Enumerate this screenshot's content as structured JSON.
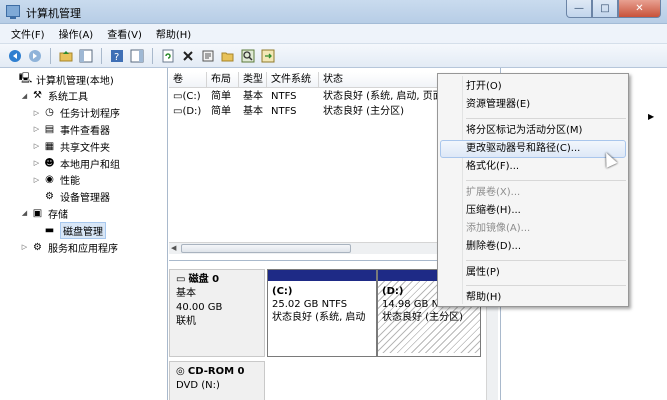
{
  "window": {
    "title": "计算机管理"
  },
  "window_buttons": {
    "minimize": "—",
    "maximize": "□",
    "close": "✕"
  },
  "menu": [
    "文件(F)",
    "操作(A)",
    "查看(V)",
    "帮助(H)"
  ],
  "toolbar_icons": [
    "back-icon",
    "forward-icon",
    "up-folder-icon",
    "show-tree-icon",
    "help-icon",
    "show-actions-icon",
    "refresh-icon",
    "delete-icon",
    "properties-icon",
    "open-icon",
    "search-icon",
    "export-icon"
  ],
  "tree": [
    {
      "label": "计算机管理(本地)",
      "icon": "computer-icon",
      "level": 0,
      "expander": "",
      "selected": false
    },
    {
      "label": "系统工具",
      "icon": "tools-icon",
      "level": 1,
      "expander": "◢",
      "selected": false
    },
    {
      "label": "任务计划程序",
      "icon": "clock-icon",
      "level": 2,
      "expander": "▷",
      "selected": false
    },
    {
      "label": "事件查看器",
      "icon": "event-viewer-icon",
      "level": 2,
      "expander": "▷",
      "selected": false
    },
    {
      "label": "共享文件夹",
      "icon": "shared-folder-icon",
      "level": 2,
      "expander": "▷",
      "selected": false
    },
    {
      "label": "本地用户和组",
      "icon": "users-icon",
      "level": 2,
      "expander": "▷",
      "selected": false
    },
    {
      "label": "性能",
      "icon": "performance-icon",
      "level": 2,
      "expander": "▷",
      "selected": false
    },
    {
      "label": "设备管理器",
      "icon": "device-manager-icon",
      "level": 2,
      "expander": "",
      "selected": false
    },
    {
      "label": "存储",
      "icon": "storage-icon",
      "level": 1,
      "expander": "◢",
      "selected": false
    },
    {
      "label": "磁盘管理",
      "icon": "disk-management-icon",
      "level": 2,
      "expander": "",
      "selected": true
    },
    {
      "label": "服务和应用程序",
      "icon": "services-icon",
      "level": 1,
      "expander": "▷",
      "selected": false
    }
  ],
  "list": {
    "columns": [
      "卷",
      "布局",
      "类型",
      "文件系统",
      "状态"
    ],
    "rows": [
      [
        "(C:)",
        "简单",
        "基本",
        "NTFS",
        "状态良好 (系统, 启动, 页面"
      ],
      [
        "(D:)",
        "简单",
        "基本",
        "NTFS",
        "状态良好 (主分区)"
      ]
    ]
  },
  "disks": [
    {
      "name": "磁盘 0",
      "type": "基本",
      "size": "40.00 GB",
      "status": "联机"
    },
    {
      "name": "CD-ROM 0",
      "type": "DVD (N:)"
    }
  ],
  "partitions": [
    {
      "drive": "(C:)",
      "size": "25.02 GB NTFS",
      "status": "状态良好 (系统, 启动",
      "selected": false
    },
    {
      "drive": "(D:)",
      "size": "14.98 GB NTFS",
      "status": "状态良好 (主分区)",
      "selected": true
    }
  ],
  "context_menu": [
    {
      "label": "打开(O)",
      "enabled": true
    },
    {
      "label": "资源管理器(E)",
      "enabled": true
    },
    {
      "separator": true
    },
    {
      "label": "将分区标记为活动分区(M)",
      "enabled": true
    },
    {
      "label": "更改驱动器号和路径(C)...",
      "enabled": true,
      "hover": true
    },
    {
      "label": "格式化(F)...",
      "enabled": true
    },
    {
      "separator": true
    },
    {
      "label": "扩展卷(X)...",
      "enabled": false
    },
    {
      "label": "压缩卷(H)...",
      "enabled": true
    },
    {
      "label": "添加镜像(A)...",
      "enabled": false
    },
    {
      "label": "删除卷(D)...",
      "enabled": true
    },
    {
      "separator": true
    },
    {
      "label": "属性(P)",
      "enabled": true
    },
    {
      "separator": true
    },
    {
      "label": "帮助(H)",
      "enabled": true
    }
  ],
  "colors": {
    "partition_header": "#1e2a86",
    "selection": "#d9e7f7",
    "titlebar": "#c9dbee"
  }
}
